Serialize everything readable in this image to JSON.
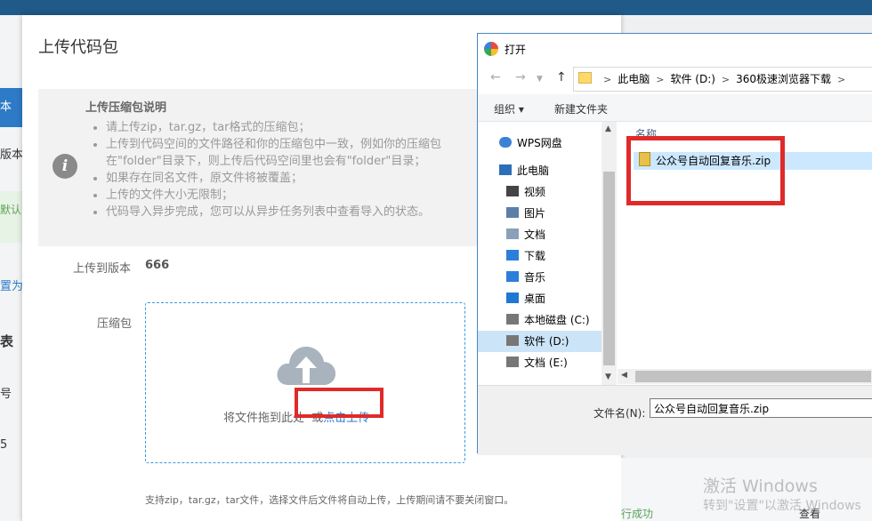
{
  "background": {
    "fragments": [
      "本",
      "版本",
      "默认",
      "置为",
      "表",
      "号",
      "5"
    ],
    "bottom_status": "行成功",
    "bottom_view": "查看"
  },
  "dialog": {
    "title": "上传代码包",
    "note_title": "上传压缩包说明",
    "notes": [
      "请上传zip，tar.gz，tar格式的压缩包；",
      "上传到代码空间的文件路径和你的压缩包中一致，例如你的压缩包",
      "在\"folder\"目录下，则上传后代码空间里也会有\"folder\"目录；",
      "如果存在同名文件，原文件将被覆盖；",
      "上传的文件大小无限制；",
      "代码导入异步完成，您可以从异步任务列表中查看导入的状态。"
    ],
    "version_label": "上传到版本",
    "version_value": "666",
    "package_label": "压缩包",
    "drop_text": "将文件拖到此处",
    "drop_or": "或",
    "drop_link": "点击上传",
    "hint": "支持zip，tar.gz，tar文件，选择文件后文件将自动上传，上传期间请不要关闭窗口。"
  },
  "file_dialog": {
    "title": "打开",
    "breadcrumb": [
      "此电脑",
      "软件 (D:)",
      "360极速浏览器下载"
    ],
    "toolbar": {
      "organize": "组织",
      "new_folder": "新建文件夹"
    },
    "nav_items": [
      {
        "label": "WPS网盘",
        "icon": "cloud-icon"
      },
      {
        "label": "此电脑",
        "icon": "computer-icon"
      },
      {
        "label": "视频",
        "icon": "video-icon"
      },
      {
        "label": "图片",
        "icon": "picture-icon"
      },
      {
        "label": "文档",
        "icon": "document-icon"
      },
      {
        "label": "下载",
        "icon": "download-icon"
      },
      {
        "label": "音乐",
        "icon": "music-icon"
      },
      {
        "label": "桌面",
        "icon": "desktop-icon"
      },
      {
        "label": "本地磁盘 (C:)",
        "icon": "drive-icon"
      },
      {
        "label": "软件 (D:)",
        "icon": "drive-icon",
        "selected": true
      },
      {
        "label": "文档 (E:)",
        "icon": "drive-icon"
      }
    ],
    "column_name": "名称",
    "file": "公众号自动回复音乐.zip",
    "filename_label": "文件名(N):",
    "filename_value": "公众号自动回复音乐.zip"
  },
  "watermark": {
    "line1": "激活 Windows",
    "line2": "转到\"设置\"以激活 Windows"
  },
  "colors": {
    "accent": "#2d7bc6",
    "highlight": "#e02a2a",
    "topbar": "#1f5a88"
  }
}
